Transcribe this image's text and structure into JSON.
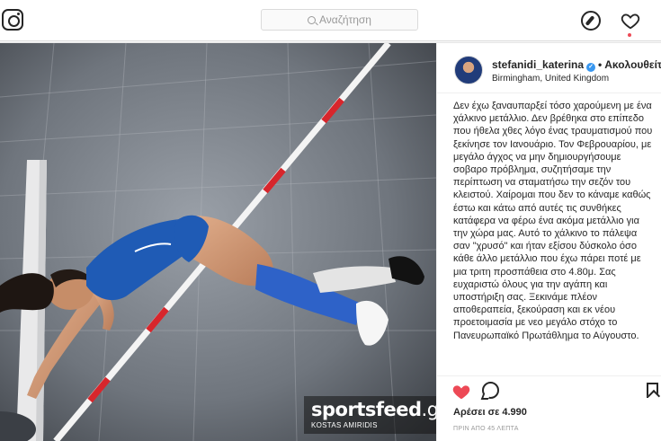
{
  "nav": {
    "search_placeholder": "Αναζήτηση",
    "logo_icon": "instagram-camera-icon",
    "explore_icon": "compass-icon",
    "activity_icon": "heart-icon",
    "accent": "#ed4956"
  },
  "post": {
    "image_alt_icon": "pole-vault-photo",
    "watermark": {
      "brand_sports": "sports",
      "brand_feed": "feed",
      "brand_tld": ".gr",
      "credit": "KOSTAS AMIRIDIS"
    },
    "author": {
      "username": "stefanidi_katerina",
      "verified_icon": "verified-badge-icon",
      "separator": "•",
      "follow_label": "Ακολουθείτε",
      "location": "Birmingham, United Kingdom"
    },
    "caption": "Δεν έχω ξαναυπαρξεί τόσο χαρούμενη με ένα χάλκινο μετάλλιο. Δεν βρέθηκα στο επίπεδο που ήθελα χθες λόγο ένας τραυματισμού που ξεκίνησε τον Ιανουάριο. Τον Φεβρουαρίου, με μεγάλο άγχος να μην δημιουργήσουμε σοβαρο πρόβλημα, συζητήσαμε την περίπτωση να σταματήσω την σεζόν του κλειστού. Χαίρομαι που δεν το κάναμε καθώς έστω και κάτω από αυτές τις συνθήκες κατάφερα να φέρω ένα ακόμα μετάλλιο για την χώρα μας. Αυτό το χάλκινο το πάλεψα σαν \"χρυσό\" και ήταν εξίσου δύσκολο όσο κάθε άλλο μετάλλιο που έχω πάρει ποτέ με μια τριτη προσπάθεια στο 4.80μ. Σας ευχαριστώ όλους για την αγάπη και υποστήριξη σας. Ξεκινάμε πλέον αποθεραπεία, ξεκούραση και εκ νέου προετοιμασία με νεο μεγάλο στόχο το Πανευρωπαϊκό Πρωτάθλημα το Αύγουστο.",
    "likes": "Αρέσει σε 4.990",
    "timestamp": "ΠΡΙΝ ΑΠΟ 45 ΛΕΠΤΑ",
    "liked_color": "#ed4956"
  }
}
